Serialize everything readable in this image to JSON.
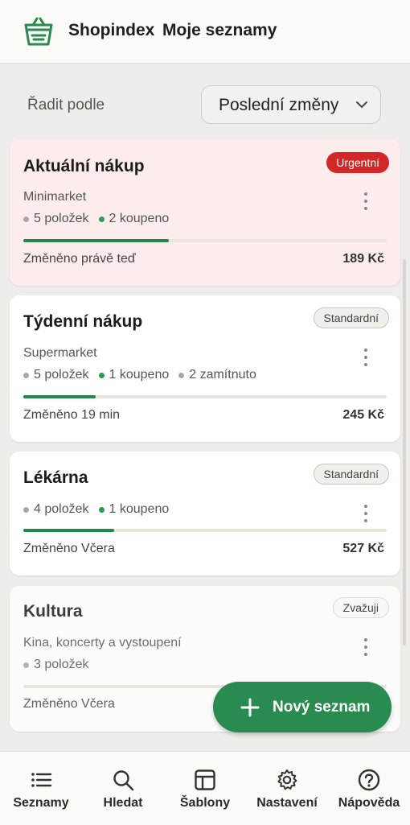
{
  "header": {
    "app_name": "Shopindex",
    "page_title": "Moje seznamy"
  },
  "sort": {
    "label": "Řadit podle",
    "value": "Poslední změny"
  },
  "colors": {
    "accent": "#2a8b51",
    "urgent": "#d32626",
    "progress": "#1f8a4a"
  },
  "lists": [
    {
      "title": "Aktuální nákup",
      "badge": "Urgentní",
      "store": "Minimarket",
      "items": "5 položek",
      "bought": "2 koupeno",
      "changed": "Změněno právě teď",
      "price": "189 Kč",
      "progress": 0.4
    },
    {
      "title": "Týdenní nákup",
      "badge": "Standardní",
      "store": "Supermarket",
      "items": "5 položek",
      "bought": "1 koupeno",
      "rejected": "2 zamítnuto",
      "changed": "Změněno 19 min",
      "price": "245 Kč",
      "progress": 0.2
    },
    {
      "title": "Lékárna",
      "badge": "Standardní",
      "items": "4 položek",
      "bought": "1 koupeno",
      "changed": "Změněno Včera",
      "price": "527 Kč",
      "progress": 0.25
    },
    {
      "title": "Kultura",
      "badge": "Zvažuji",
      "store": "Kina, koncerty a vystoupení",
      "items": "3 položek",
      "changed": "Změněno Včera",
      "progress": 0
    }
  ],
  "fab": {
    "label": "Nový seznam"
  },
  "nav": [
    {
      "label": "Seznamy",
      "icon": "list-icon"
    },
    {
      "label": "Hledat",
      "icon": "search-icon"
    },
    {
      "label": "Šablony",
      "icon": "template-icon"
    },
    {
      "label": "Nastavení",
      "icon": "gear-icon"
    },
    {
      "label": "Nápověda",
      "icon": "help-icon"
    }
  ]
}
